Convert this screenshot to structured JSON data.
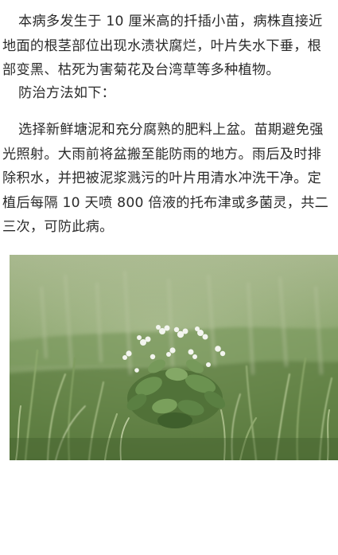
{
  "article": {
    "paragraphs": [
      "本病多发生于 10 厘米高的扦插小苗，病株直接近地面的根茎部位出现水渍状腐烂，叶片失水下垂，根部变黑、枯死为害菊花及台湾草等多种植物。",
      "防治方法如下：",
      "选择新鲜塘泥和充分腐熟的肥料上盆。苗期避免强光照射。大雨前将盆搬至能防雨的地方。雨后及时排除积水，并把被泥浆溅污的叶片用清水冲洗干净。定植后每隔 10 天喷 800 倍液的托布津或多菌灵，共二三次，可防此病。"
    ]
  },
  "photo": {
    "colors": {
      "background_top": "#a8b88e",
      "background_mid": "#7e9b62",
      "grass_dark": "#46672f",
      "grass_light": "#92ad72",
      "flower_white": "#f3f5ef",
      "leaf_green": "#5e8446"
    }
  }
}
